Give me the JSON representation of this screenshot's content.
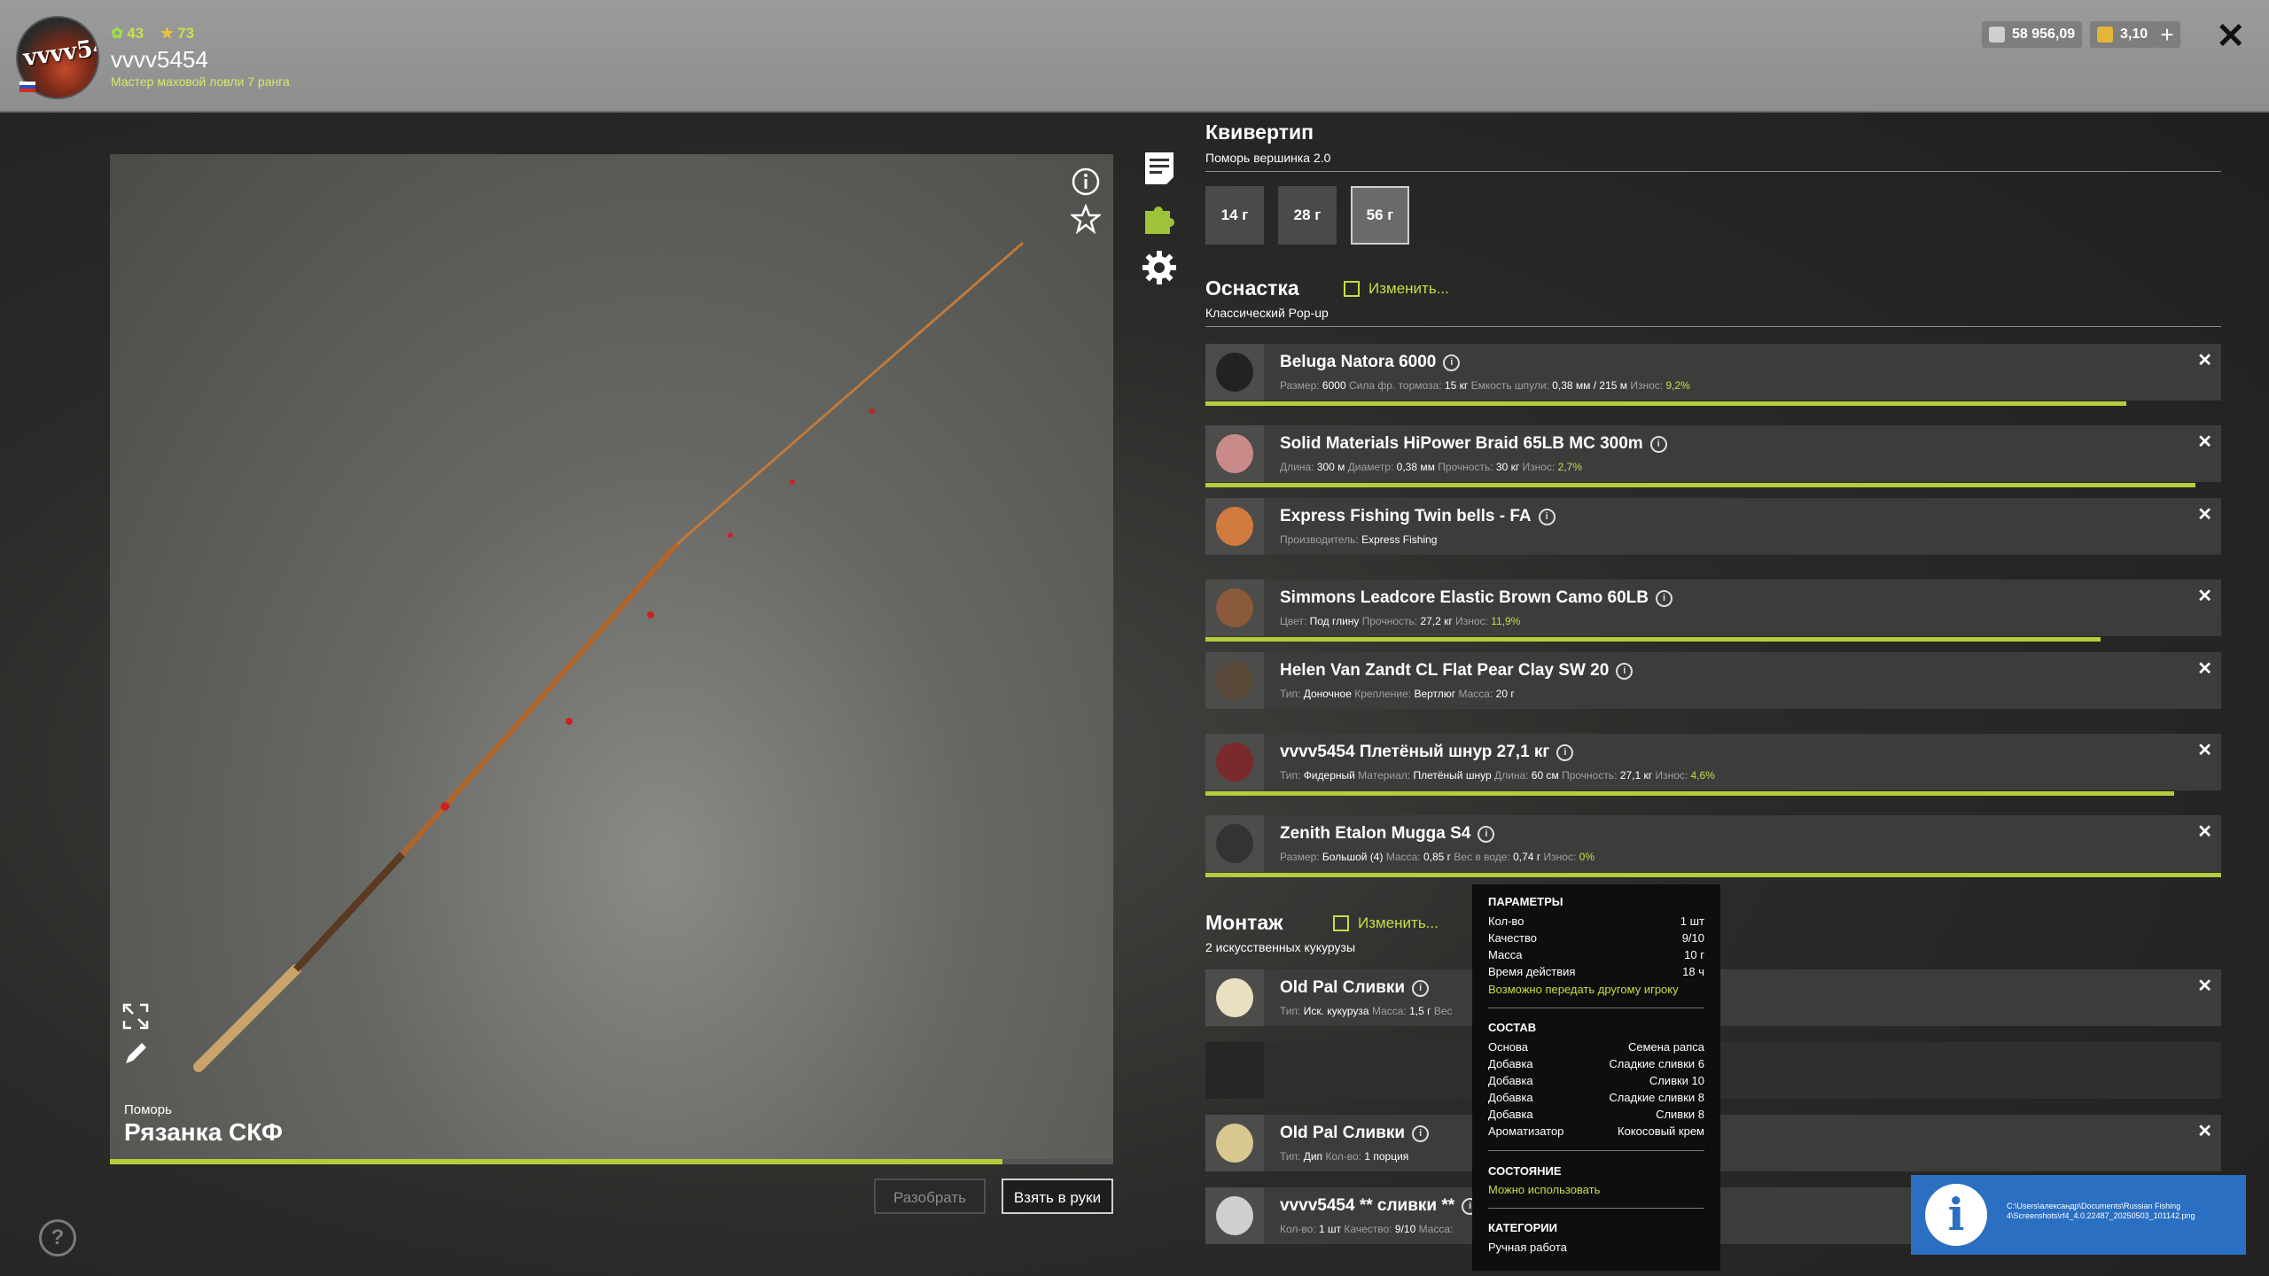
{
  "header": {
    "avatar_text": "vvvv5454",
    "level": "43",
    "stars": "73",
    "username": "vvvv5454",
    "rank": "Мастер маховой ловли 7 ранга",
    "silver": "58 956,09",
    "gold": "3,10",
    "plus": "+",
    "close": "✕"
  },
  "rod": {
    "brand": "Поморь",
    "name": "Рязанка СКФ",
    "progress": 0.89,
    "disassemble_label": "Разобрать",
    "take_label": "Взять в руки"
  },
  "quivertip": {
    "title": "Квивертип",
    "subtitle": "Поморь вершинка 2.0",
    "weights": [
      "14 г",
      "28 г",
      "56 г"
    ],
    "selected": "56 г"
  },
  "rig": {
    "title": "Оснастка",
    "change_label": "Изменить...",
    "subtitle": "Классический Pop-up",
    "items": [
      {
        "name": "Beluga Natora 6000",
        "params": [
          [
            "Размер:",
            "6000"
          ],
          [
            "Сила фр. тормоза:",
            "15 кг"
          ],
          [
            "Емкость шпули:",
            "0,38 мм / 215 м"
          ],
          [
            "Износ:",
            "9,2%"
          ]
        ],
        "wear": 0.907,
        "thumb": "reel-icon"
      },
      {
        "name": "Solid Materials HiPower Braid 65LB MC 300m",
        "params": [
          [
            "Длина:",
            "300 м"
          ],
          [
            "Диаметр:",
            "0,38 мм"
          ],
          [
            "Прочность:",
            "30 кг"
          ],
          [
            "Износ:",
            "2,7%"
          ]
        ],
        "wear": 0.975,
        "thumb": "line-spool-icon"
      },
      {
        "name": "Express Fishing Twin bells - FA",
        "params": [
          [
            "Производитель:",
            "Express Fishing"
          ]
        ],
        "wear": null,
        "thumb": "bells-icon"
      },
      {
        "name": "Simmons Leadcore Elastic Brown Camo 60LB",
        "params": [
          [
            "Цвет:",
            "Под глину"
          ],
          [
            "Прочность:",
            "27,2 кг"
          ],
          [
            "Износ:",
            "11,9%"
          ]
        ],
        "wear": 0.881,
        "thumb": "leadcore-icon"
      },
      {
        "name": "Helen Van Zandt CL Flat Pear Clay SW 20",
        "params": [
          [
            "Тип:",
            "Доночное"
          ],
          [
            "Крепление:",
            "Вертлюг"
          ],
          [
            "Масса:",
            "20 г"
          ]
        ],
        "wear": null,
        "thumb": "sinker-icon"
      },
      {
        "name": "vvvv5454 Плетёный шнур 27,1 кг",
        "params": [
          [
            "Тип:",
            "Фидерный"
          ],
          [
            "Материал:",
            "Плетёный шнур"
          ],
          [
            "Длина:",
            "60 см"
          ],
          [
            "Прочность:",
            "27,1 кг"
          ],
          [
            "Износ:",
            "4,6%"
          ]
        ],
        "wear": 0.954,
        "thumb": "leader-icon"
      },
      {
        "name": "Zenith Etalon Mugga S4",
        "params": [
          [
            "Размер:",
            "Большой (4)"
          ],
          [
            "Масса:",
            "0,85 г"
          ],
          [
            "Вес в воде:",
            "0,74 г"
          ],
          [
            "Износ:",
            "0%"
          ]
        ],
        "wear": 1.0,
        "thumb": "hook-icon"
      }
    ]
  },
  "montage": {
    "title": "Монтаж",
    "change_label": "Изменить...",
    "subtitle": "2 искусственных кукурузы",
    "items": [
      {
        "name": "Old Pal Сливки",
        "params": [
          [
            "Тип:",
            "Иск. кукуруза"
          ],
          [
            "Масса:",
            "1,5 г"
          ],
          [
            "Вес",
            ""
          ]
        ],
        "thumb": "bait-jar-icon"
      },
      {
        "name": "Old Pal Сливки",
        "params": [
          [
            "Тип:",
            "Дип"
          ],
          [
            "Кол-во:",
            "1 порция"
          ]
        ],
        "thumb": "dip-bottle-icon"
      },
      {
        "name": "vvvv5454 ** сливки **",
        "params": [
          [
            "Кол-во:",
            "1 шт"
          ],
          [
            "Качество:",
            "9/10"
          ],
          [
            "Масса:",
            ""
          ]
        ],
        "thumb": "pva-bag-icon"
      }
    ]
  },
  "tooltip": {
    "params_title": "Параметры",
    "params": [
      [
        "Кол-во",
        "1 шт"
      ],
      [
        "Качество",
        "9/10"
      ],
      [
        "Масса",
        "10 г"
      ],
      [
        "Время действия",
        "18 ч"
      ]
    ],
    "transfer_note": "Возможно передать другому игроку",
    "composition_title": "Состав",
    "composition": [
      [
        "Основа",
        "Семена рапса"
      ],
      [
        "Добавка",
        "Сладкие сливки 6"
      ],
      [
        "Добавка",
        "Сливки 10"
      ],
      [
        "Добавка",
        "Сладкие сливки 8"
      ],
      [
        "Добавка",
        "Сливки 8"
      ],
      [
        "Ароматизатор",
        "Кокосовый крем"
      ]
    ],
    "state_title": "Состояние",
    "state_value": "Можно использовать",
    "category_title": "Категории",
    "category_value": "Ручная работа"
  },
  "notification": {
    "icon": "i",
    "path": "C:\\Users\\александр\\Documents\\Russian Fishing 4\\Screenshots\\rf4_4.0.22487_20250503_101142.png"
  },
  "colors": {
    "accent": "#c8dd47",
    "wear_bar": "#b7cc3a",
    "notification": "#2a6fc1"
  }
}
